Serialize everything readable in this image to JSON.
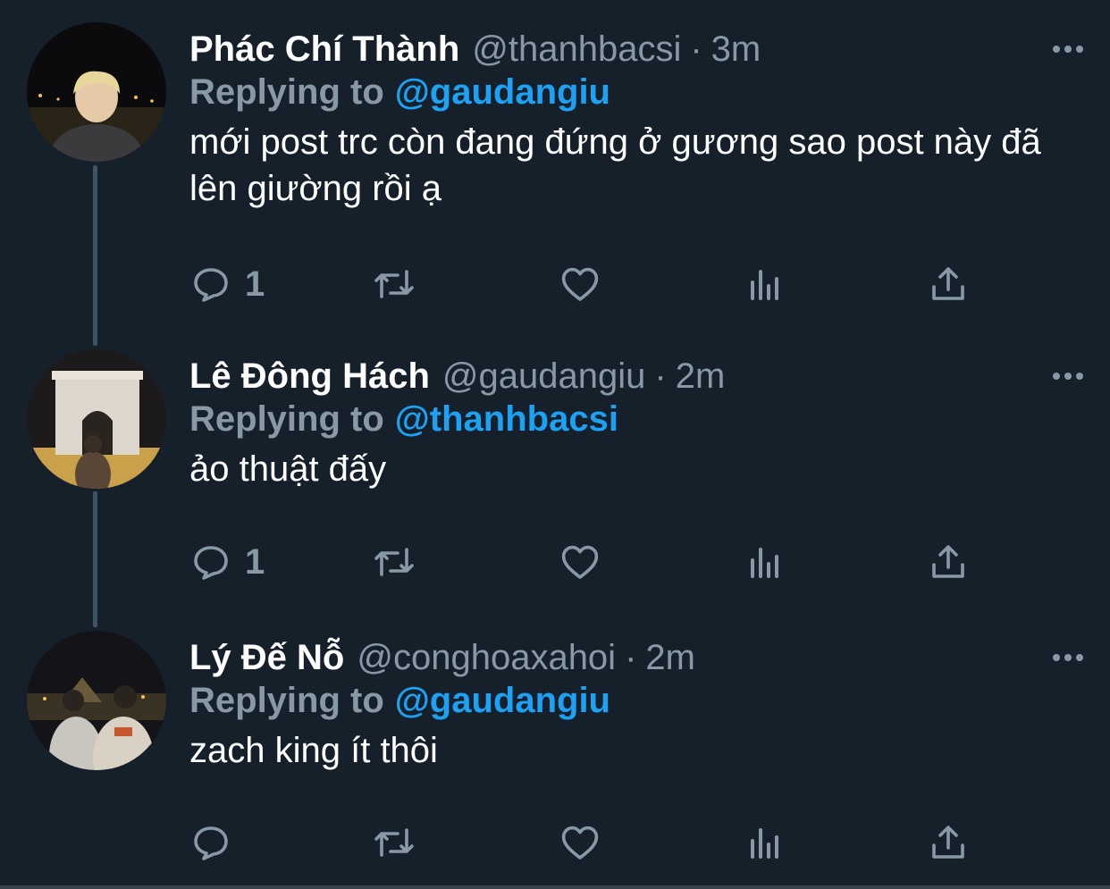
{
  "tweets": [
    {
      "name": "Phác Chí Thành",
      "handle": "@thanhbacsi",
      "separator": "·",
      "time": "3m",
      "replying_label": "Replying to",
      "replying_to": "@gaudangiu",
      "text": "mới post trc còn đang đứng ở gương sao post này đã lên giường rồi ạ",
      "reply_count": "1",
      "avatar_icon": "avatar-blond-boy-night"
    },
    {
      "name": "Lê Đông Hách",
      "handle": "@gaudangiu",
      "separator": "·",
      "time": "2m",
      "replying_label": "Replying to",
      "replying_to": "@thanhbacsi",
      "text": "ảo thuật đấy",
      "reply_count": "1",
      "avatar_icon": "avatar-arc-de-triomphe"
    },
    {
      "name": "Lý Đế Nỗ",
      "handle": "@conghoaxahoi",
      "separator": "·",
      "time": "2m",
      "replying_label": "Replying to",
      "replying_to": "@gaudangiu",
      "text": "zach king ít thôi",
      "reply_count": "",
      "avatar_icon": "avatar-louvre-couple"
    }
  ],
  "colors": {
    "background": "#15202b",
    "secondary_text": "#8899a6",
    "link": "#1da1f2",
    "thread_line": "#3d5466"
  },
  "icons": [
    "reply-icon",
    "retweet-icon",
    "like-icon",
    "analytics-icon",
    "share-icon",
    "more-icon"
  ]
}
